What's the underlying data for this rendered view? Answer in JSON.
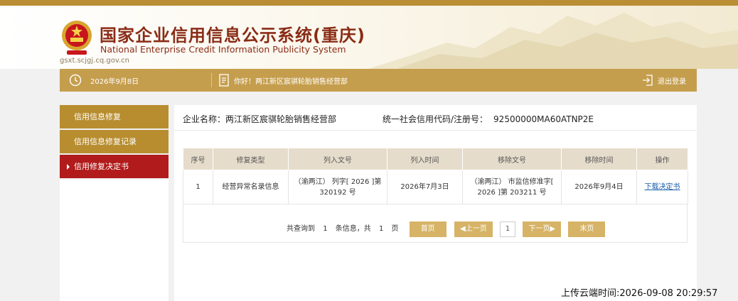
{
  "header": {
    "title_cn": "国家企业信用信息公示系统(重庆)",
    "title_en": "National Enterprise Credit Information Publicity System",
    "site_url": "gsxt.scjgj.cq.gov.cn"
  },
  "nav": {
    "date": "2026年9月8日",
    "greeting": "你好！两江新区宸骐轮胎销售经营部",
    "logout": "退出登录"
  },
  "sidebar": {
    "items": [
      {
        "label": "信用信息修复",
        "active": false
      },
      {
        "label": "信用信息修复记录",
        "active": false
      },
      {
        "label": "信用修复决定书",
        "active": true
      }
    ]
  },
  "main": {
    "company_label": "企业名称：两江新区宸骐轮胎销售经营部",
    "code_label": "统一社会信用代码/注册号：",
    "code_value": "92500000MA60ATNP2E",
    "table": {
      "headers": [
        "序号",
        "修复类型",
        "列入文号",
        "列入时间",
        "移除文号",
        "移除时间",
        "操作"
      ],
      "rows": [
        {
          "index": "1",
          "type": "经营异常名录信息",
          "list_doc": "（渝两江） 列字[ 2026 ]第 320192 号",
          "list_time": "2026年7月3日",
          "remove_doc": "（渝两江） 市监信修准字[ 2026 ]第 203211 号",
          "remove_time": "2026年9月4日",
          "action": "下载决定书"
        }
      ]
    },
    "pager": {
      "t1": "共查询到",
      "total": "1",
      "t2": "条信息，共",
      "pages": "1",
      "t3": "页",
      "first": "首页",
      "prev": "◀上一页",
      "current": "1",
      "next": "下一页▶",
      "last": "末页"
    }
  },
  "upload_time": "上传云端时间:2026-09-08 20:29:57",
  "colors": {
    "gold": "#c59e4d",
    "sidebar_gold": "#b88d2f",
    "active_red": "#b11b1b",
    "title_red": "#8a2c16"
  }
}
